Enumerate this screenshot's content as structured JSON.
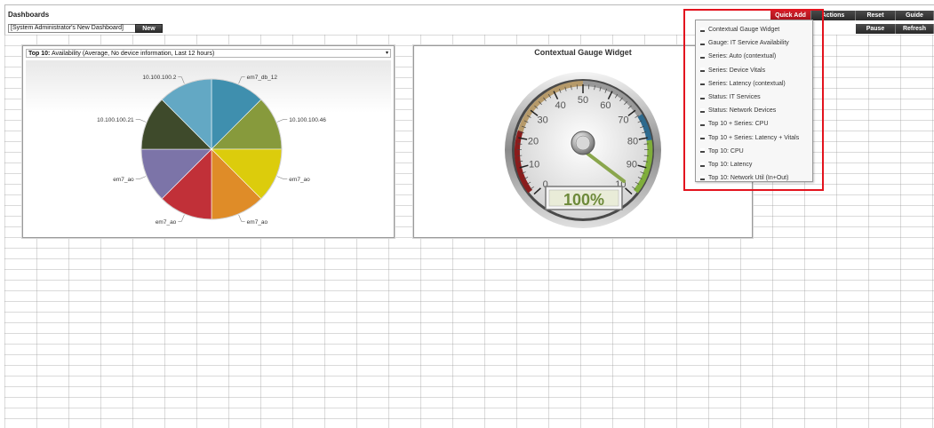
{
  "header": {
    "title": "Dashboards",
    "dashboard_select": "[System Administrator's New Dashboard]",
    "new_label": "New"
  },
  "toolbar": {
    "quick_add": "Quick Add",
    "actions": "Actions",
    "reset": "Reset",
    "guide": "Guide",
    "pause": "Pause",
    "refresh": "Refresh"
  },
  "quick_add_menu": {
    "items": [
      "Contextual Gauge Widget",
      "Gauge: IT Service Availability",
      "Series: Auto (contextual)",
      "Series: Device Vitals",
      "Series: Latency (contextual)",
      "Status: IT Services",
      "Status: Network Devices",
      "Top 10 + Series: CPU",
      "Top 10 + Series: Latency + Vitals",
      "Top 10: CPU",
      "Top 10: Latency",
      "Top 10: Network Util (In+Out)"
    ]
  },
  "pie_widget": {
    "title_bold": "Top 10:",
    "title_rest": "Availability (Average, No device information, Last 12 hours)"
  },
  "gauge_widget": {
    "title": "Contextual Gauge Widget",
    "value_text": "100%",
    "ticks": [
      "0",
      "10",
      "20",
      "30",
      "40",
      "50",
      "60",
      "70",
      "80",
      "90",
      "10"
    ]
  },
  "chart_data": {
    "type": "pie",
    "title": "Top 10: Availability (Average, No device information, Last 12 hours)",
    "slices": [
      {
        "label": "em7_db_12",
        "value": 1,
        "color": "#3f8fae"
      },
      {
        "label": "10.100.100.46",
        "value": 1,
        "color": "#879a3c"
      },
      {
        "label": "em7_ao",
        "value": 1,
        "color": "#dccc0c"
      },
      {
        "label": "em7_ao",
        "value": 1,
        "color": "#df8c28"
      },
      {
        "label": "em7_ao",
        "value": 1,
        "color": "#c13038"
      },
      {
        "label": "em7_ao",
        "value": 1,
        "color": "#7c74a8"
      },
      {
        "label": "10.100.100.21",
        "value": 1,
        "color": "#3e4a2b"
      },
      {
        "label": "10.100.100.2",
        "value": 1,
        "color": "#63a8c4"
      }
    ]
  }
}
